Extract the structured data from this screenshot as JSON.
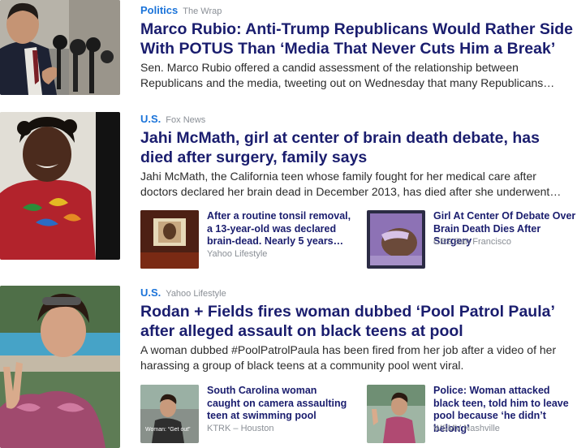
{
  "stories": [
    {
      "category": "Politics",
      "source": "The Wrap",
      "headline": "Marco Rubio: Anti-Trump Republicans Would Rather Side With POTUS Than ‘Media That Never Cuts Him a Break’",
      "summary": "Sen. Marco Rubio offered a candid assessment of the relationship between Republicans and the media, tweeting out on Wednesday that many Republicans…"
    },
    {
      "category": "U.S.",
      "source": "Fox News",
      "headline": "Jahi McMath, girl at center of brain death debate, has died after surgery, family says",
      "summary": "Jahi McMath, the California teen whose family fought for her medical care after doctors declared her brain dead in December 2013, has died after she underwent…",
      "related": [
        {
          "title": "After a routine tonsil removal, a 13-year-old was declared brain-dead. Nearly 5 years…",
          "source": "Yahoo Lifestyle"
        },
        {
          "title": "Girl At Center Of Debate Over Brain Death Dies After Surgery",
          "source": "CBS San Francisco"
        }
      ]
    },
    {
      "category": "U.S.",
      "source": "Yahoo Lifestyle",
      "headline": "Rodan + Fields fires woman dubbed ‘Pool Patrol Paula’ after alleged assault on black teens at pool",
      "summary": "A woman dubbed #PoolPatrolPaula has been fired from her job after a video of her harassing a group of black teens at a community pool went viral.",
      "related": [
        {
          "title": "South Carolina woman caught on camera assaulting teen at swimming pool",
          "source": "KTRK – Houston",
          "thumb_caption": "Woman: “Get out”"
        },
        {
          "title": "Police: Woman attacked black teen, told him to leave pool because ‘he didn’t belong’",
          "source": "WSMV Nashville"
        }
      ]
    }
  ],
  "colors": {
    "category": "#1a73d9",
    "headline": "#1a1d6e",
    "summary": "#2b2b2b",
    "source": "#8a8f96"
  }
}
